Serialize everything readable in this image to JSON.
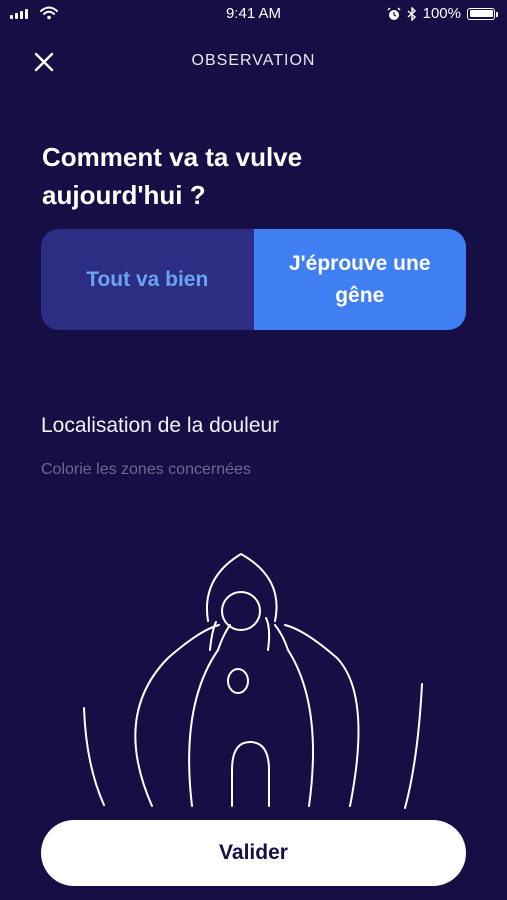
{
  "status_bar": {
    "time": "9:41 AM",
    "battery": "100%",
    "icons": [
      "signal-icon",
      "wifi-icon",
      "alarm-icon",
      "bluetooth-icon",
      "battery-icon"
    ]
  },
  "header": {
    "title": "OBSERVATION",
    "close_icon": "close-icon"
  },
  "question": {
    "line1": "Comment va ta vulve",
    "line2": "aujourd'hui ?"
  },
  "options": {
    "left": "Tout va bien",
    "right_line1": "J'éprouve une",
    "right_line2": "gêne",
    "selected": "right"
  },
  "pain": {
    "title": "Localisation de la douleur",
    "hint": "Colorie les zones concernées"
  },
  "actions": {
    "validate": "Valider"
  },
  "colors": {
    "background": "#150f45",
    "segment_inactive": "#2c2d83",
    "segment_active": "#3f7ff2",
    "inactive_text": "#6aa3f2",
    "hint_text": "#6b6890"
  }
}
